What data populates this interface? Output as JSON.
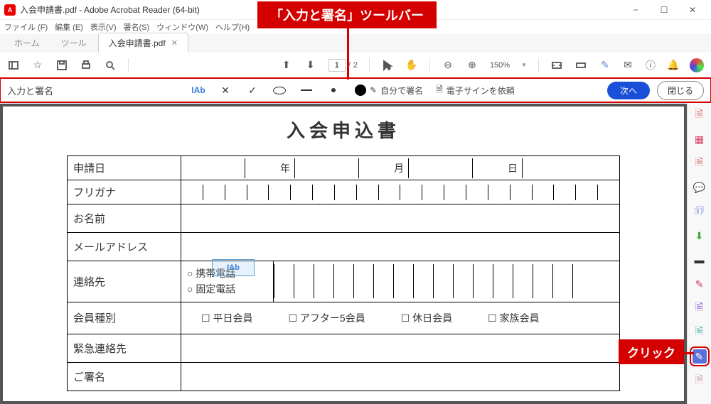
{
  "window": {
    "title": "入会申請書.pdf - Adobe Acrobat Reader (64-bit)"
  },
  "menu": {
    "file": "ファイル (F)",
    "edit": "編集 (E)",
    "view": "表示(V)",
    "sign": "署名(S)",
    "window": "ウィンドウ(W)",
    "help": "ヘルプ(H)"
  },
  "tabs": {
    "home": "ホーム",
    "tools": "ツール",
    "file_name": "入会申請書.pdf"
  },
  "toolbar": {
    "page_current": "1",
    "page_total": "2",
    "zoom": "150%"
  },
  "sign_bar": {
    "label": "入力と署名",
    "text_tool": "IAb",
    "self_sign": "自分で署名",
    "request_esign": "電子サインを依頼",
    "next": "次へ",
    "close": "閉じる"
  },
  "document": {
    "title": "入会申込書",
    "cursor_label": "IAb",
    "rows": {
      "apply_date": "申請日",
      "year": "年",
      "month": "月",
      "day": "日",
      "furigana": "フリガナ",
      "name": "お名前",
      "email": "メールアドレス",
      "contact": "連絡先",
      "mobile": "携帯電話",
      "landline": "固定電話",
      "member_type": "会員種別",
      "mt1": "平日会員",
      "mt2": "アフター5会員",
      "mt3": "休日会員",
      "mt4": "家族会員",
      "emergency": "緊急連絡先",
      "signature": "ご署名"
    }
  },
  "callouts": {
    "toolbar": "「入力と署名」ツールバー",
    "click": "クリック"
  },
  "colors": {
    "accent_red": "#d40000",
    "accent_blue": "#1a4fd8"
  }
}
